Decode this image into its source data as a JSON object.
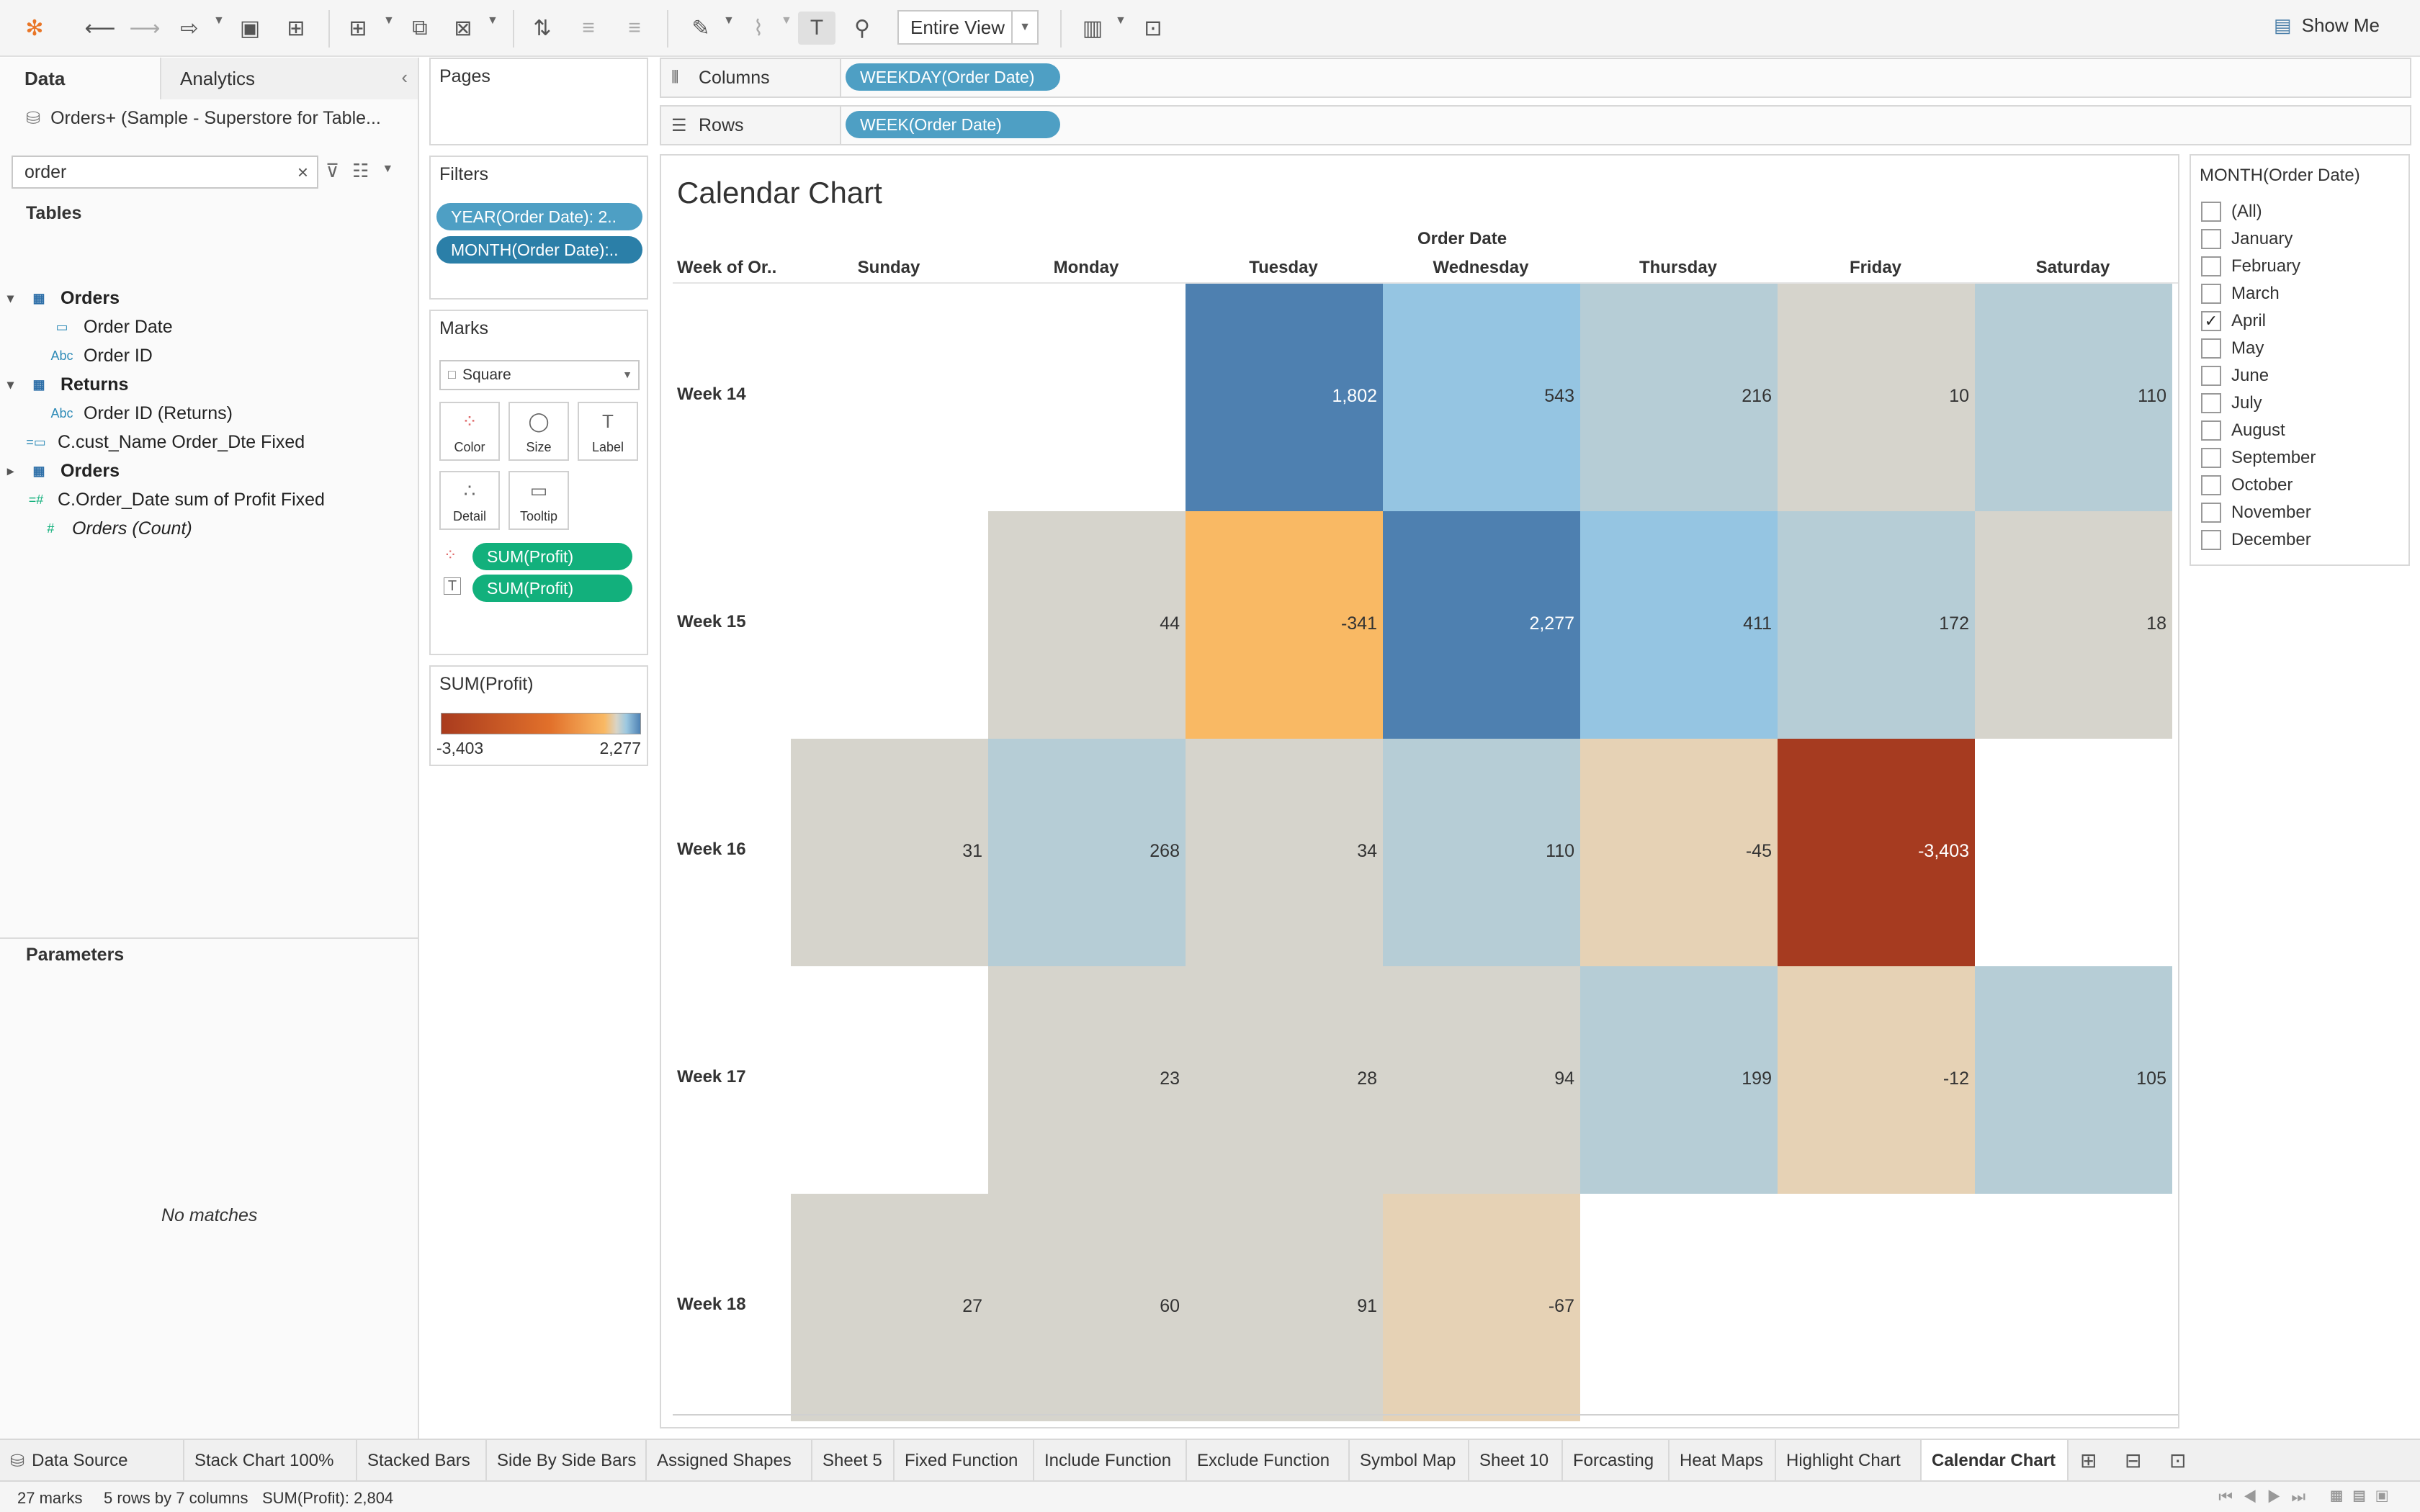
{
  "toolbar": {
    "view_select": "Entire View",
    "show_me": "Show Me"
  },
  "data_pane": {
    "tab_data": "Data",
    "tab_analytics": "Analytics",
    "datasource": "Orders+ (Sample - Superstore for Table...",
    "search_value": "order",
    "tables_header": "Tables",
    "fields": [
      {
        "label": "Orders",
        "icon": "table-icon",
        "style": "bold",
        "caret": "▾"
      },
      {
        "label": "Order Date",
        "icon": "calendar-icon",
        "style": "normal",
        "caret": ""
      },
      {
        "label": "Order ID",
        "icon": "abc-icon",
        "style": "normal",
        "caret": ""
      },
      {
        "label": "Returns",
        "icon": "table-icon",
        "style": "bold",
        "caret": "▾"
      },
      {
        "label": "Order ID (Returns)",
        "icon": "abc-icon",
        "style": "normal",
        "caret": ""
      },
      {
        "label": "C.cust_Name Order_Dte Fixed",
        "icon": "calc-icon",
        "style": "normal",
        "caret": ""
      },
      {
        "label": "Orders",
        "icon": "table-icon",
        "style": "bold",
        "caret": "▸"
      },
      {
        "label": "C.Order_Date sum of Profit Fixed",
        "icon": "calc-measure-icon",
        "style": "normal",
        "caret": ""
      },
      {
        "label": "Orders (Count)",
        "icon": "measure-icon",
        "style": "italic",
        "caret": ""
      }
    ],
    "icon_glyphs": {
      "abc": "Abc",
      "hash": "#",
      "calendar": "▭"
    },
    "parameters_header": "Parameters",
    "no_matches": "No matches"
  },
  "pages": {
    "title": "Pages"
  },
  "filters": {
    "title": "Filters",
    "pills": [
      "YEAR(Order Date): 2..",
      "MONTH(Order Date):.."
    ]
  },
  "marks": {
    "title": "Marks",
    "type": "Square",
    "buttons": [
      "Color",
      "Size",
      "Label",
      "Detail",
      "Tooltip"
    ],
    "pills": [
      "SUM(Profit)",
      "SUM(Profit)"
    ]
  },
  "legend": {
    "title": "SUM(Profit)",
    "min": "-3,403",
    "max": "2,277"
  },
  "shelves": {
    "columns_label": "Columns",
    "columns_pill": "WEEKDAY(Order Date)",
    "rows_label": "Rows",
    "rows_pill": "WEEK(Order Date)"
  },
  "chart_data": {
    "type": "heatmap",
    "title": "Calendar Chart",
    "column_group_header": "Order Date",
    "row_header": "Week of Or..",
    "columns": [
      "Sunday",
      "Monday",
      "Tuesday",
      "Wednesday",
      "Thursday",
      "Friday",
      "Saturday"
    ],
    "rows": [
      "Week 14",
      "Week 15",
      "Week 16",
      "Week 17",
      "Week 18"
    ],
    "values": [
      [
        null,
        null,
        1802,
        543,
        216,
        10,
        110
      ],
      [
        null,
        44,
        -341,
        2277,
        411,
        172,
        18
      ],
      [
        31,
        268,
        34,
        110,
        -45,
        -3403,
        null
      ],
      [
        null,
        23,
        28,
        94,
        199,
        -12,
        105
      ],
      [
        27,
        60,
        91,
        -67,
        null,
        null,
        null
      ]
    ],
    "labels": [
      [
        "",
        "",
        "1,802",
        "543",
        "216",
        "10",
        "110"
      ],
      [
        "",
        "44",
        "-341",
        "2,277",
        "411",
        "172",
        "18"
      ],
      [
        "31",
        "268",
        "34",
        "110",
        "-45",
        "-3,403",
        ""
      ],
      [
        "",
        "23",
        "28",
        "94",
        "199",
        "-12",
        "105"
      ],
      [
        "27",
        "60",
        "91",
        "-67",
        "",
        "",
        ""
      ]
    ],
    "color_range": [
      -3403,
      2277
    ],
    "colors": {
      "neg_strong": "#a63b20",
      "neg_mid": "#f9b964",
      "neg_light": "#e6d2b5",
      "neutral": "#d6d4cc",
      "pos_light": "#b6cdd6",
      "pos_mid": "#95c5e2",
      "pos_strong": "#4e80b0"
    }
  },
  "month_filter": {
    "title": "MONTH(Order Date)",
    "items": [
      {
        "label": "(All)",
        "checked": false
      },
      {
        "label": "January",
        "checked": false
      },
      {
        "label": "February",
        "checked": false
      },
      {
        "label": "March",
        "checked": false
      },
      {
        "label": "April",
        "checked": true
      },
      {
        "label": "May",
        "checked": false
      },
      {
        "label": "June",
        "checked": false
      },
      {
        "label": "July",
        "checked": false
      },
      {
        "label": "August",
        "checked": false
      },
      {
        "label": "September",
        "checked": false
      },
      {
        "label": "October",
        "checked": false
      },
      {
        "label": "November",
        "checked": false
      },
      {
        "label": "December",
        "checked": false
      }
    ]
  },
  "sheet_tabs": [
    {
      "label": "Data Source",
      "active": false
    },
    {
      "label": "Stack Chart 100%",
      "active": false
    },
    {
      "label": "Stacked Bars",
      "active": false
    },
    {
      "label": "Side By Side Bars",
      "active": false
    },
    {
      "label": "Assigned Shapes",
      "active": false
    },
    {
      "label": "Sheet 5",
      "active": false
    },
    {
      "label": "Fixed Function",
      "active": false
    },
    {
      "label": "Include Function",
      "active": false
    },
    {
      "label": "Exclude Function",
      "active": false
    },
    {
      "label": "Symbol Map",
      "active": false
    },
    {
      "label": "Sheet 10",
      "active": false
    },
    {
      "label": "Forcasting",
      "active": false
    },
    {
      "label": "Heat Maps",
      "active": false
    },
    {
      "label": "Highlight Chart",
      "active": false
    },
    {
      "label": "Calendar Chart",
      "active": true
    }
  ],
  "status": {
    "marks": "27 marks",
    "dims": "5 rows by 7 columns",
    "sum": "SUM(Profit): 2,804"
  }
}
